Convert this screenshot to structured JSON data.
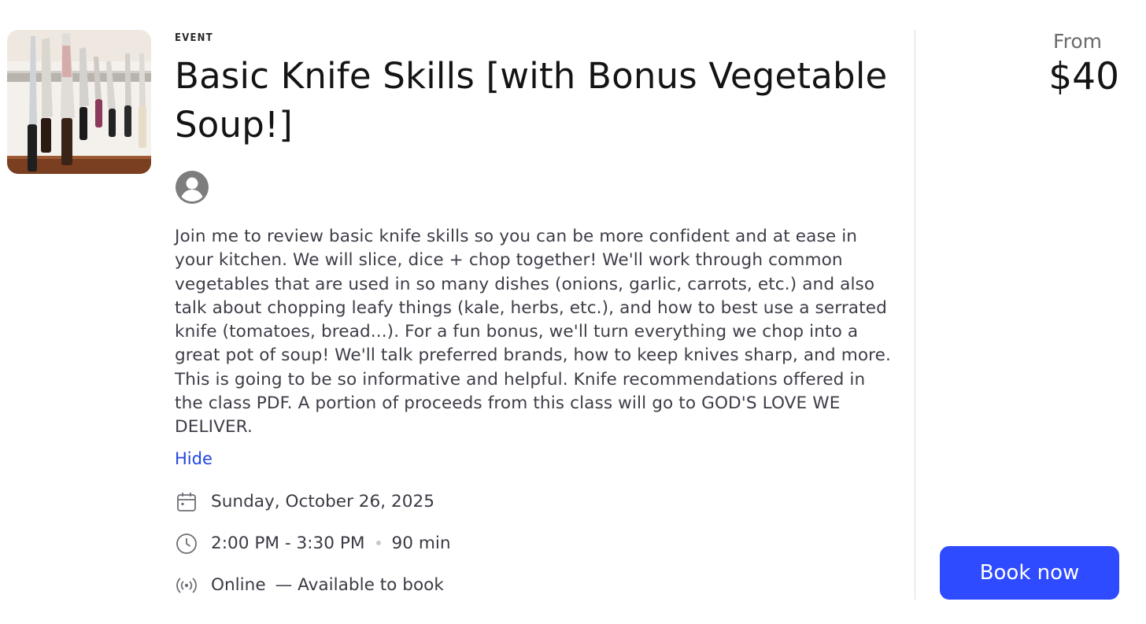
{
  "event": {
    "image_alt": "knives-on-magnetic-strip",
    "eyebrow": "EVENT",
    "title": "Basic Knife Skills [with Bonus Vegetable Soup!]",
    "host_icon": "user-circle-icon",
    "description": "Join me to review basic knife skills so you can be more confident and at ease in your kitchen. We will slice, dice + chop together! We'll work through common vegetables that are used in so many dishes (onions, garlic, carrots, etc.) and also talk about chopping leafy things (kale, herbs, etc.), and how to best use a serrated knife (tomatoes, bread...). For a fun bonus, we'll turn everything we chop into a great pot of soup! We'll talk preferred brands, how to keep knives sharp, and more. This is going to be so informative and helpful. Knife recommendations offered in the class PDF. A portion of proceeds from this class will go to GOD'S LOVE WE DELIVER.",
    "toggle_label": "Hide",
    "date": {
      "icon": "calendar-icon",
      "text": "Sunday, October 26, 2025"
    },
    "time": {
      "icon": "clock-icon",
      "range": "2:00 PM - 3:30 PM",
      "duration": "90 min"
    },
    "location": {
      "icon": "broadcast-icon",
      "text": "Online",
      "availability": "— Available to book"
    }
  },
  "pricing": {
    "from_label": "From",
    "price": "$40",
    "book_label": "Book now"
  },
  "colors": {
    "accent_button": "#2f4bff",
    "link": "#2345e0",
    "body_text": "#3d3d48"
  }
}
